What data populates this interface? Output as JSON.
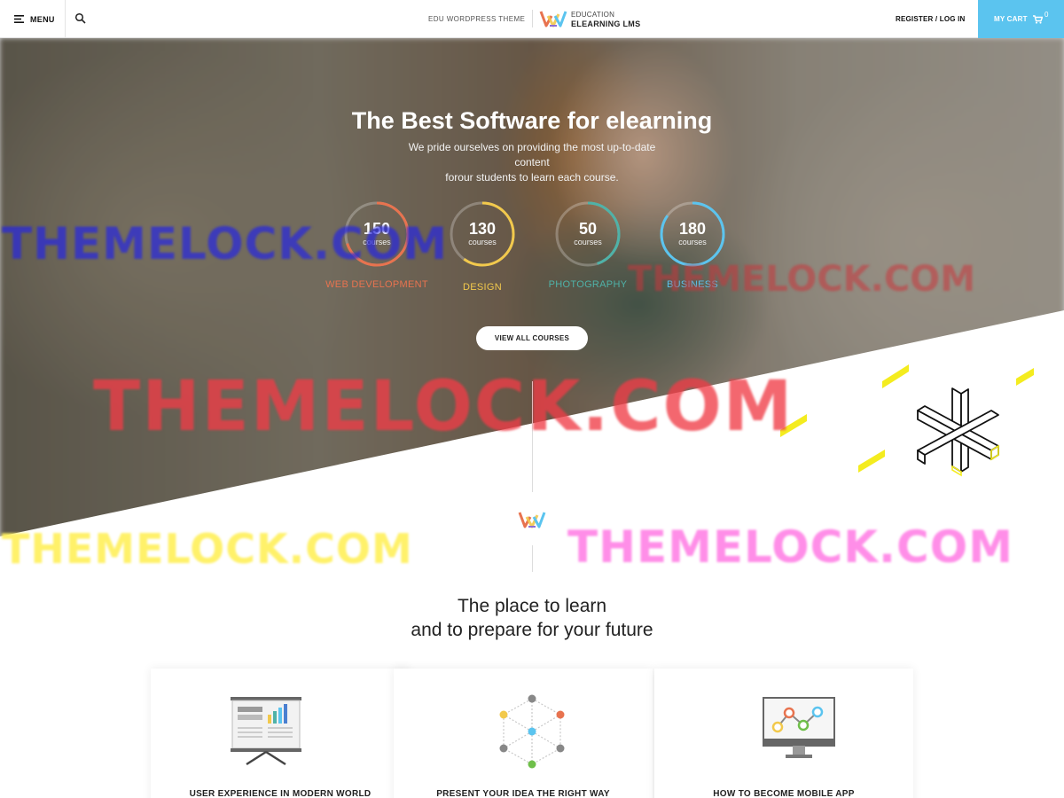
{
  "header": {
    "menu_label": "MENU",
    "tagline": "EDU WORDPRESS THEME",
    "logo_top": "EDUCATION",
    "logo_bottom": "ELEARNING LMS",
    "register_label": "REGISTER / LOG IN",
    "cart_label": "MY CART",
    "cart_count": "0",
    "accent_color": "#5bc4ef"
  },
  "hero": {
    "title": "The Best Software for elearning",
    "subtitle_line1": "We pride ourselves on providing the most up-to-date content",
    "subtitle_line2": "forour students to learn each course.",
    "stats": [
      {
        "value": "150",
        "unit": "courses",
        "category": "WEB DEVELOPMENT",
        "color": "#e8734f",
        "progress": 0.7
      },
      {
        "value": "130",
        "unit": "courses",
        "category": "DESIGN",
        "color": "#f2c94c",
        "progress": 0.6
      },
      {
        "value": "50",
        "unit": "courses",
        "category": "PHOTOGRAPHY",
        "color": "#4fb2a8",
        "progress": 0.45
      },
      {
        "value": "180",
        "unit": "courses",
        "category": "BUSINESS",
        "color": "#5bc4ef",
        "progress": 0.85
      }
    ],
    "button_label": "VIEW ALL COURSES"
  },
  "section": {
    "title_line1": "The place to learn",
    "title_line2": "and to prepare for your future",
    "cards": [
      {
        "title": "USER EXPERIENCE IN MODERN WORLD",
        "icon": "presentation-board-icon"
      },
      {
        "title": "PRESENT YOUR IDEA THE RIGHT WAY",
        "icon": "network-cube-icon"
      },
      {
        "title": "HOW TO BECOME MOBILE APP",
        "icon": "monitor-chart-icon"
      }
    ]
  },
  "watermarks": [
    "THEMELOCK.COM",
    "THEMELOCK.COM",
    "THEMELOCK.COM",
    "THEMELOCK.COM",
    "THEMELOCK.COM"
  ]
}
